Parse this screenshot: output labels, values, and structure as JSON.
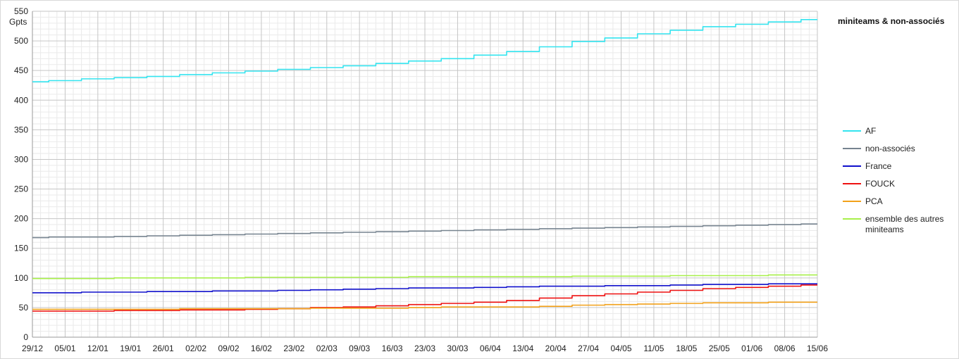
{
  "chart_data": {
    "type": "line",
    "title": "miniteams & non-associés",
    "ylabel": "Gpts",
    "ylim": [
      0,
      550
    ],
    "yticks": [
      0,
      50,
      100,
      150,
      200,
      250,
      300,
      350,
      400,
      450,
      500,
      550
    ],
    "x_tick_labels": [
      "29/12",
      "05/01",
      "12/01",
      "19/01",
      "26/01",
      "02/02",
      "09/02",
      "16/02",
      "23/02",
      "02/03",
      "09/03",
      "16/03",
      "23/03",
      "30/03",
      "06/04",
      "13/04",
      "20/04",
      "27/04",
      "04/05",
      "11/05",
      "18/05",
      "25/05",
      "01/06",
      "08/06",
      "15/06"
    ],
    "x_days": [
      0,
      7,
      14,
      21,
      28,
      35,
      42,
      49,
      56,
      63,
      70,
      77,
      84,
      91,
      98,
      105,
      112,
      119,
      126,
      133,
      140,
      147,
      154,
      161,
      168
    ],
    "xlim": [
      0,
      168
    ],
    "grid": true,
    "legend_position": "right",
    "series": [
      {
        "name": "AF",
        "color": "#33e4ef",
        "x": [
          0,
          7,
          14,
          21,
          28,
          35,
          42,
          49,
          56,
          63,
          70,
          77,
          84,
          91,
          98,
          105,
          112,
          119,
          126,
          133,
          140,
          147,
          154,
          161,
          168
        ],
        "y": [
          431,
          433,
          436,
          438,
          440,
          443,
          446,
          449,
          452,
          455,
          458,
          462,
          466,
          470,
          476,
          482,
          490,
          499,
          505,
          512,
          518,
          524,
          528,
          532,
          536
        ]
      },
      {
        "name": "non-associés",
        "color": "#76838f",
        "x": [
          0,
          7,
          14,
          21,
          28,
          35,
          42,
          49,
          56,
          63,
          70,
          77,
          84,
          91,
          98,
          105,
          112,
          119,
          126,
          133,
          140,
          147,
          154,
          161,
          168
        ],
        "y": [
          168,
          169,
          169,
          170,
          171,
          172,
          173,
          174,
          175,
          176,
          177,
          178,
          179,
          180,
          181,
          182,
          183,
          184,
          185,
          186,
          187,
          188,
          189,
          190,
          191
        ]
      },
      {
        "name": "France",
        "color": "#1010cc",
        "x": [
          0,
          7,
          14,
          21,
          28,
          35,
          42,
          49,
          56,
          63,
          70,
          77,
          84,
          91,
          98,
          105,
          112,
          119,
          126,
          133,
          140,
          147,
          154,
          161,
          168
        ],
        "y": [
          75,
          75,
          76,
          76,
          77,
          77,
          78,
          78,
          79,
          80,
          81,
          82,
          83,
          83,
          84,
          85,
          86,
          86,
          87,
          87,
          88,
          89,
          89,
          90,
          90
        ]
      },
      {
        "name": "FOUCK",
        "color": "#ee1111",
        "x": [
          0,
          7,
          14,
          21,
          28,
          35,
          42,
          49,
          56,
          63,
          70,
          77,
          84,
          91,
          98,
          105,
          112,
          119,
          126,
          133,
          140,
          147,
          154,
          161,
          168
        ],
        "y": [
          44,
          44,
          44,
          45,
          45,
          46,
          46,
          47,
          48,
          50,
          51,
          53,
          55,
          57,
          59,
          62,
          66,
          70,
          73,
          76,
          79,
          82,
          84,
          86,
          88
        ]
      },
      {
        "name": "PCA",
        "color": "#f2a11a",
        "x": [
          0,
          7,
          14,
          21,
          28,
          35,
          42,
          49,
          56,
          63,
          70,
          77,
          84,
          91,
          98,
          105,
          112,
          119,
          126,
          133,
          140,
          147,
          154,
          161,
          168
        ],
        "y": [
          47,
          47,
          47,
          47,
          47,
          48,
          48,
          48,
          48,
          49,
          49,
          49,
          50,
          51,
          51,
          51,
          52,
          54,
          55,
          56,
          57,
          58,
          58,
          59,
          59
        ]
      },
      {
        "name": "ensemble des autres miniteams",
        "color": "#a8f04a",
        "x": [
          0,
          7,
          14,
          21,
          28,
          35,
          42,
          49,
          56,
          63,
          70,
          77,
          84,
          91,
          98,
          105,
          112,
          119,
          126,
          133,
          140,
          147,
          154,
          161,
          168
        ],
        "y": [
          99,
          99,
          99,
          100,
          100,
          100,
          100,
          101,
          101,
          101,
          101,
          101,
          102,
          102,
          102,
          102,
          102,
          103,
          103,
          103,
          104,
          104,
          104,
          105,
          105
        ]
      }
    ]
  }
}
